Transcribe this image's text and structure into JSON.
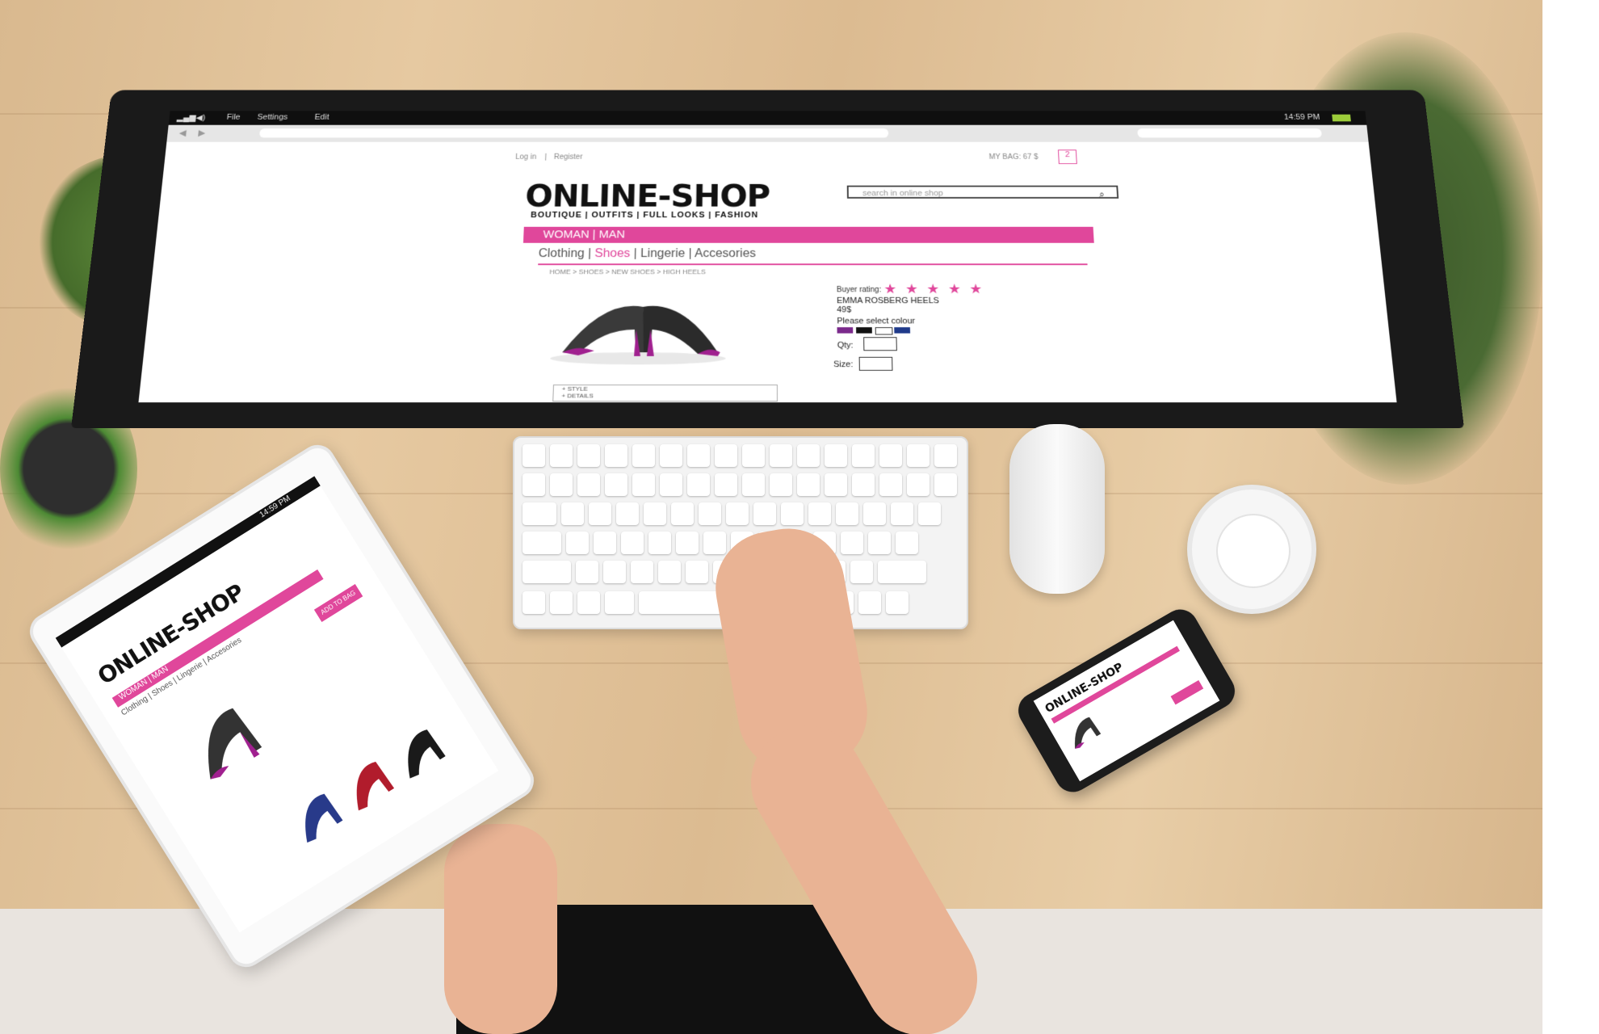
{
  "os_bar": {
    "menu_file": "File",
    "menu_settings": "Settings",
    "menu_edit": "Edit",
    "clock": "14:59",
    "clock_suffix": "PM"
  },
  "shop": {
    "login": "Log in",
    "separator": "|",
    "register": "Register",
    "bag_label": "MY BAG: 67 $",
    "bag_count": "2",
    "logo": "ONLINE-SHOP",
    "tagline": "BOUTIQUE | OUTFITS | FULL LOOKS | FASHION",
    "search_placeholder": "search in online shop",
    "main_nav": "WOMAN   |   MAN",
    "subnav": {
      "clothing": "Clothing",
      "sep1": " | ",
      "shoes": "Shoes",
      "sep2": " | ",
      "lingerie": "Lingerie",
      "sep3": " | ",
      "accessories": "Accesories"
    },
    "breadcrumb": "HOME > SHOES > NEW SHOES > HIGH HEELS",
    "rating_label": "Buyer rating:",
    "stars": "★ ★ ★ ★ ★",
    "product_name": "EMMA ROSBERG HEELS",
    "price": "49$",
    "colour_label": "Please select colour",
    "qty_label": "Qty:",
    "size_label": "Size:",
    "accordion_style": "+ STYLE",
    "accordion_details": "+ DETAILS"
  },
  "tablet": {
    "clock": "14:59",
    "clock_suffix": "PM",
    "logo": "ONLINE-SHOP",
    "main_nav": "WOMAN | MAN",
    "subnav": "Clothing | Shoes | Lingerie | Accesories",
    "add_button": "ADD TO BAG"
  },
  "phone": {
    "logo": "ONLINE-SHOP"
  },
  "colors": {
    "accent_pink": "#e0479b",
    "swatch_purple": "#7b2a8c",
    "swatch_black": "#111111",
    "swatch_white": "#ffffff",
    "swatch_navy": "#1f3a8a"
  }
}
